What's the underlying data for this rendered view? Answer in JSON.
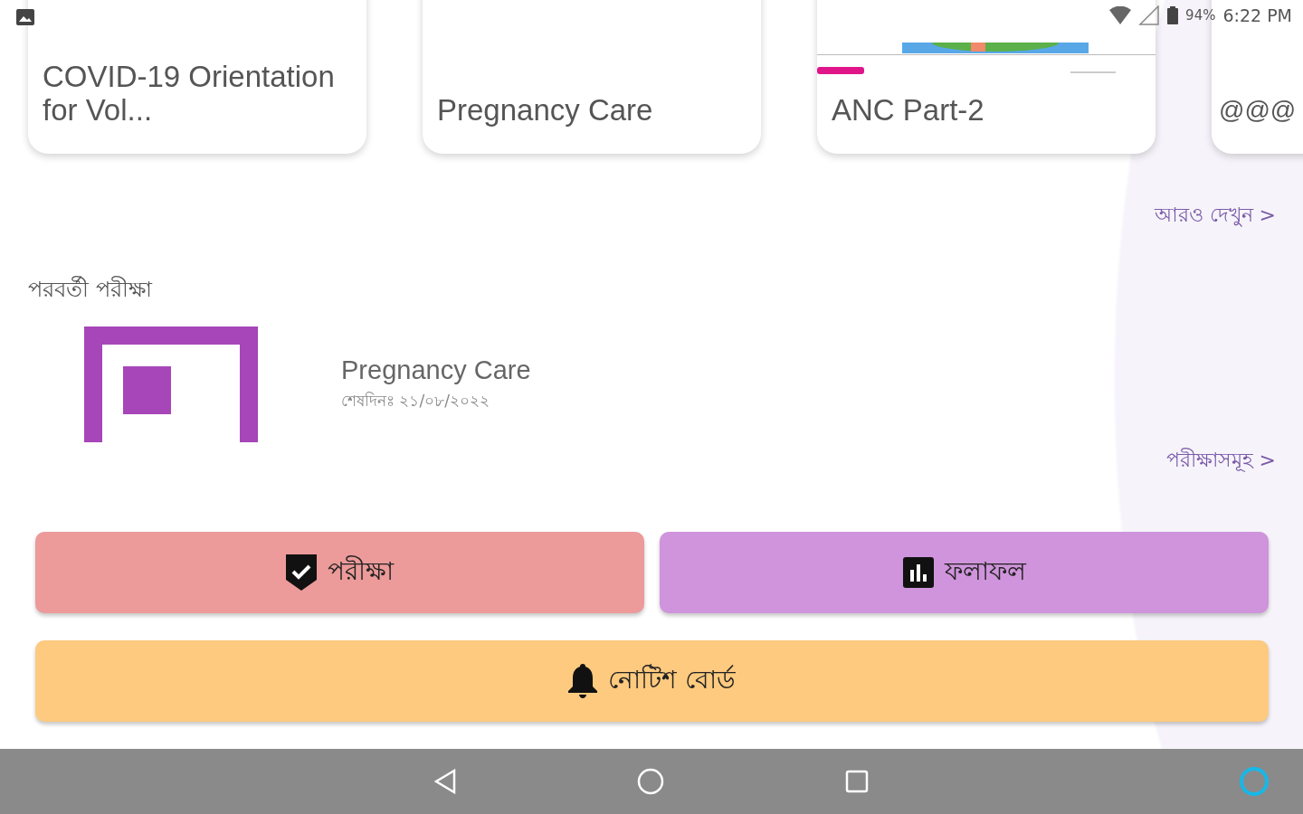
{
  "status_bar": {
    "battery": "94%",
    "time": "6:22 PM"
  },
  "courses": [
    {
      "title": "COVID-19 Orientation for Vol...",
      "kind": "plain"
    },
    {
      "title": "Pregnancy Care",
      "kind": "plain"
    },
    {
      "title": "ANC Part-2",
      "kind": "picture"
    },
    {
      "title": "@@@",
      "kind": "plain"
    }
  ],
  "more_link": "আরও দেখুন >",
  "next_exam": {
    "heading": "পরবর্তী পরীক্ষা",
    "title": "Pregnancy Care",
    "deadline": "শেষদিনঃ ২১/০৮/২০২২"
  },
  "exams_link": "পরীক্ষাসমূহ >",
  "buttons": [
    {
      "label": "পরীক্ষা",
      "kind": "shield",
      "color": "#ec9a9a"
    },
    {
      "label": "ফলাফল",
      "kind": "chart",
      "color": "#cf94db"
    },
    {
      "label": "নোটিশ বোর্ড",
      "kind": "bell",
      "color": "#fdca7f"
    }
  ]
}
